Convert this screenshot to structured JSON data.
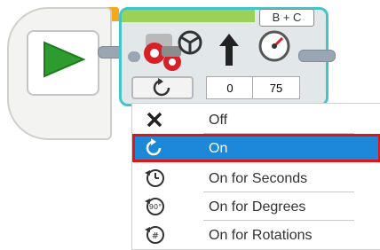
{
  "motor_block": {
    "ports": "B + C",
    "steering_value": "0",
    "power_value": "75"
  },
  "mode_menu": {
    "items": [
      {
        "label": "Off",
        "icon": "x-icon",
        "selected": false
      },
      {
        "label": "On",
        "icon": "on-icon",
        "selected": true
      },
      {
        "label": "On for Seconds",
        "icon": "seconds-icon",
        "selected": false
      },
      {
        "label": "On for Degrees",
        "icon": "degrees-icon",
        "selected": false
      },
      {
        "label": "On for Rotations",
        "icon": "rotations-icon",
        "selected": false
      }
    ],
    "selected_color": "#1e88d8",
    "highlight_border": "#e01616"
  },
  "colors": {
    "start_accent": "#f3a81e",
    "motor_accent": "#9ad15a",
    "block_border": "#43c5c8",
    "play": "#2e9b2e"
  }
}
